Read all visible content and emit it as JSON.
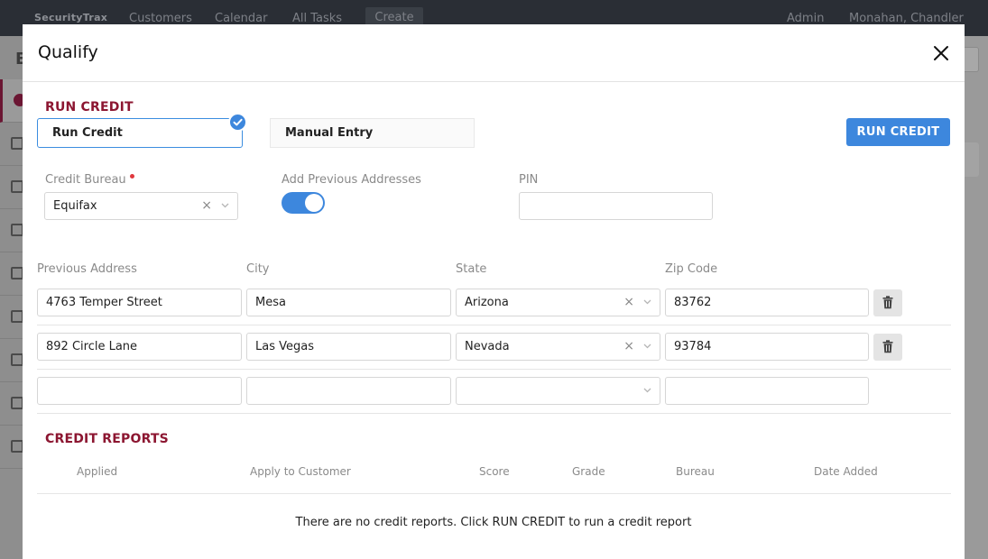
{
  "app": {
    "brand": "SecurityTrax",
    "nav": [
      "Customers",
      "Calendar",
      "All Tasks",
      "Create"
    ],
    "user_role": "Admin",
    "user_name": "Monahan, Chandler",
    "bg_title_letter": "E"
  },
  "modal": {
    "title": "Qualify",
    "run_credit_section": {
      "title": "RUN CREDIT",
      "options": [
        "Run Credit",
        "Manual Entry"
      ],
      "selected": "Run Credit",
      "run_button": "RUN CREDIT"
    },
    "form": {
      "credit_bureau_label": "Credit Bureau",
      "credit_bureau_value": "Equifax",
      "add_prev_label": "Add Previous Addresses",
      "add_prev_enabled": true,
      "pin_label": "PIN",
      "pin_value": ""
    },
    "addresses": {
      "headers": {
        "address": "Previous Address",
        "city": "City",
        "state": "State",
        "zip": "Zip Code"
      },
      "rows": [
        {
          "address": "4763 Temper Street",
          "city": "Mesa",
          "state": "Arizona",
          "zip": "83762"
        },
        {
          "address": "892 Circle Lane",
          "city": "Las Vegas",
          "state": "Nevada",
          "zip": "93784"
        },
        {
          "address": "",
          "city": "",
          "state": "",
          "zip": ""
        }
      ]
    },
    "credit_reports": {
      "title": "CREDIT REPORTS",
      "columns": [
        "Applied",
        "Apply to Customer",
        "Score",
        "Grade",
        "Bureau",
        "Date Added"
      ],
      "empty_message": "There are no credit reports. Click RUN CREDIT to run a credit report"
    }
  },
  "colors": {
    "accent": "#3d87dd",
    "section_title": "#8c1631",
    "required": "#e0383e"
  },
  "icons": {
    "close": "close-icon",
    "check": "check-icon",
    "trash": "trash-icon",
    "chevron": "chevron-down-icon",
    "clear": "clear-icon"
  }
}
